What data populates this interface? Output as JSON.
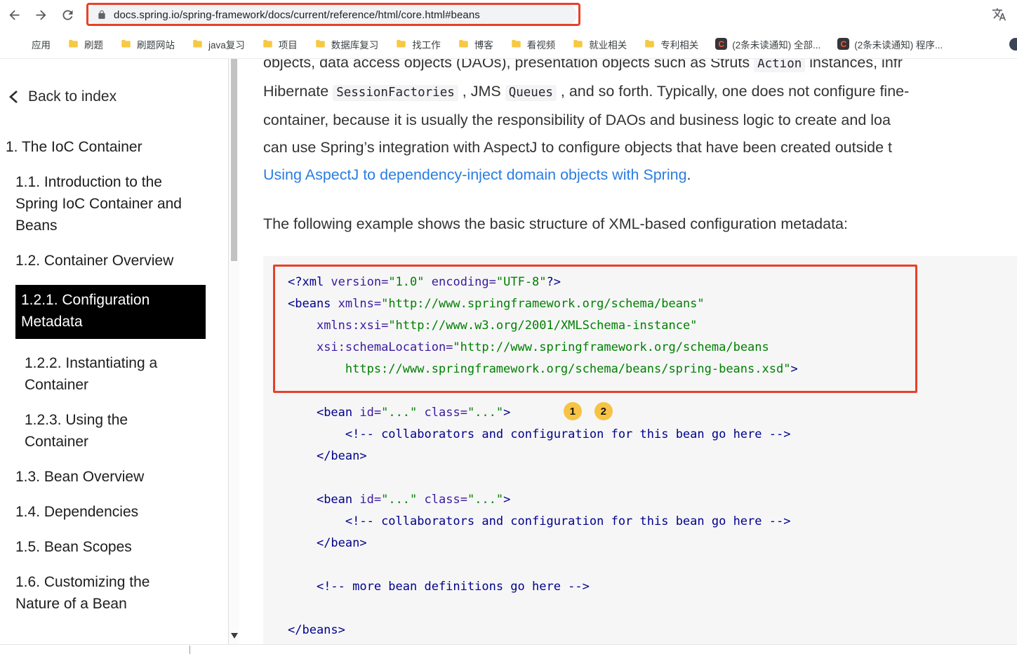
{
  "browser": {
    "toolbar": {
      "url": "docs.spring.io/spring-framework/docs/current/reference/html/core.html#beans",
      "icons": [
        "back-arrow",
        "forward-arrow",
        "refresh",
        "lock",
        "translate"
      ]
    },
    "bookmarks": [
      {
        "icon": "apps-grid",
        "label": "应用"
      },
      {
        "icon": "folder",
        "label": "刷题"
      },
      {
        "icon": "folder",
        "label": "刷题网站"
      },
      {
        "icon": "folder",
        "label": "java复习"
      },
      {
        "icon": "folder",
        "label": "项目"
      },
      {
        "icon": "folder",
        "label": "数据库复习"
      },
      {
        "icon": "folder",
        "label": "找工作"
      },
      {
        "icon": "folder",
        "label": "博客"
      },
      {
        "icon": "folder",
        "label": "看视频"
      },
      {
        "icon": "folder",
        "label": "就业相关"
      },
      {
        "icon": "folder",
        "label": "专利相关"
      },
      {
        "icon": "csdn",
        "label": "(2条未读通知) 全部..."
      },
      {
        "icon": "csdn",
        "label": "(2条未读通知) 程序..."
      }
    ]
  },
  "sidebar": {
    "back_label": "Back to index",
    "items": [
      {
        "label": "1. The IoC Container",
        "level": 1,
        "selected": false
      },
      {
        "label": "1.1. Introduction to the Spring IoC Container and Beans",
        "level": 2,
        "selected": false
      },
      {
        "label": "1.2. Container Overview",
        "level": 2,
        "selected": false
      },
      {
        "label": "1.2.1. Configuration Metadata",
        "level": 3,
        "selected": true
      },
      {
        "label": "1.2.2. Instantiating a Container",
        "level": 3,
        "selected": false
      },
      {
        "label": "1.2.3. Using the Container",
        "level": 3,
        "selected": false
      },
      {
        "label": "1.3. Bean Overview",
        "level": 2,
        "selected": false
      },
      {
        "label": "1.4. Dependencies",
        "level": 2,
        "selected": false
      },
      {
        "label": "1.5. Bean Scopes",
        "level": 2,
        "selected": false
      },
      {
        "label": "1.6. Customizing the Nature of a Bean",
        "level": 2,
        "selected": false
      }
    ]
  },
  "content": {
    "paragraph_lines": [
      [
        {
          "t": "text",
          "s": "objects, data access objects (DAOs), presentation objects such as Struts "
        },
        {
          "t": "code",
          "s": "Action"
        },
        {
          "t": "text",
          "s": " instances, infr"
        }
      ],
      [
        {
          "t": "text",
          "s": "Hibernate "
        },
        {
          "t": "code",
          "s": "SessionFactories"
        },
        {
          "t": "text",
          "s": " , JMS "
        },
        {
          "t": "code",
          "s": "Queues"
        },
        {
          "t": "text",
          "s": " , and so forth. Typically, one does not configure fine-"
        }
      ],
      [
        {
          "t": "text",
          "s": "container, because it is usually the responsibility of DAOs and business logic to create and loa"
        }
      ],
      [
        {
          "t": "text",
          "s": "can use Spring’s integration with AspectJ to configure objects that have been created outside t"
        }
      ],
      [
        {
          "t": "link",
          "s": "Using AspectJ to dependency-inject domain objects with Spring"
        },
        {
          "t": "text",
          "s": "."
        }
      ]
    ],
    "intro": "The following example shows the basic structure of XML-based configuration metadata:",
    "code_lines": [
      [
        {
          "c": "tag",
          "t": "<?xml "
        },
        {
          "c": "attr",
          "t": "version="
        },
        {
          "c": "val",
          "t": "\"1.0\""
        },
        {
          "c": "pln",
          "t": " "
        },
        {
          "c": "attr",
          "t": "encoding="
        },
        {
          "c": "val",
          "t": "\"UTF-8\""
        },
        {
          "c": "tag",
          "t": "?>"
        }
      ],
      [
        {
          "c": "tag",
          "t": "<beans "
        },
        {
          "c": "attr",
          "t": "xmlns="
        },
        {
          "c": "val",
          "t": "\"http://www.springframework.org/schema/beans\""
        }
      ],
      [
        {
          "c": "pln",
          "t": "    "
        },
        {
          "c": "attr",
          "t": "xmlns:xsi="
        },
        {
          "c": "val",
          "t": "\"http://www.w3.org/2001/XMLSchema-instance\""
        }
      ],
      [
        {
          "c": "pln",
          "t": "    "
        },
        {
          "c": "attr",
          "t": "xsi:schemaLocation="
        },
        {
          "c": "val",
          "t": "\"http://www.springframework.org/schema/beans"
        }
      ],
      [
        {
          "c": "val",
          "t": "        https://www.springframework.org/schema/beans/spring-beans.xsd\""
        },
        {
          "c": "tag",
          "t": ">"
        }
      ],
      [],
      [
        {
          "c": "pln",
          "t": "    "
        },
        {
          "c": "tag",
          "t": "<bean "
        },
        {
          "c": "attr",
          "t": "id="
        },
        {
          "c": "val",
          "t": "\"...\""
        },
        {
          "c": "pln",
          "t": " "
        },
        {
          "c": "attr",
          "t": "class="
        },
        {
          "c": "val",
          "t": "\"...\""
        },
        {
          "c": "tag",
          "t": ">"
        },
        {
          "c": "pln",
          "t": "      "
        },
        {
          "c": "callout",
          "t": "1"
        },
        {
          "c": "callout",
          "t": "2"
        }
      ],
      [
        {
          "c": "pln",
          "t": "        "
        },
        {
          "c": "com",
          "t": "<!-- collaborators and configuration for this bean go here -->"
        }
      ],
      [
        {
          "c": "pln",
          "t": "    "
        },
        {
          "c": "tag",
          "t": "</bean>"
        }
      ],
      [],
      [
        {
          "c": "pln",
          "t": "    "
        },
        {
          "c": "tag",
          "t": "<bean "
        },
        {
          "c": "attr",
          "t": "id="
        },
        {
          "c": "val",
          "t": "\"...\""
        },
        {
          "c": "pln",
          "t": " "
        },
        {
          "c": "attr",
          "t": "class="
        },
        {
          "c": "val",
          "t": "\"...\""
        },
        {
          "c": "tag",
          "t": ">"
        }
      ],
      [
        {
          "c": "pln",
          "t": "        "
        },
        {
          "c": "com",
          "t": "<!-- collaborators and configuration for this bean go here -->"
        }
      ],
      [
        {
          "c": "pln",
          "t": "    "
        },
        {
          "c": "tag",
          "t": "</bean>"
        }
      ],
      [],
      [
        {
          "c": "pln",
          "t": "    "
        },
        {
          "c": "com",
          "t": "<!-- more bean definitions go here -->"
        }
      ],
      [],
      [
        {
          "c": "tag",
          "t": "</beans>"
        }
      ]
    ]
  },
  "colors": {
    "annotation_red": "#e8402a",
    "link_blue": "#2a7de2",
    "code_tag": "#00008b",
    "code_attr": "#3a1a9e",
    "code_value": "#008000",
    "code_comment": "#00008b",
    "code_block_bg": "#f6f6f7",
    "callout_bg": "#f6c344",
    "selected_bg": "#000000",
    "selected_fg": "#ffffff",
    "csdn_red": "#fc5531",
    "folder_yellow": "#f7c843",
    "apps_grid": [
      "#ea4335",
      "#fbbc05",
      "#34a853",
      "#4285f4",
      "#ea4335",
      "#34a853",
      "#fbbc05",
      "#4285f4",
      "#34a853"
    ]
  }
}
